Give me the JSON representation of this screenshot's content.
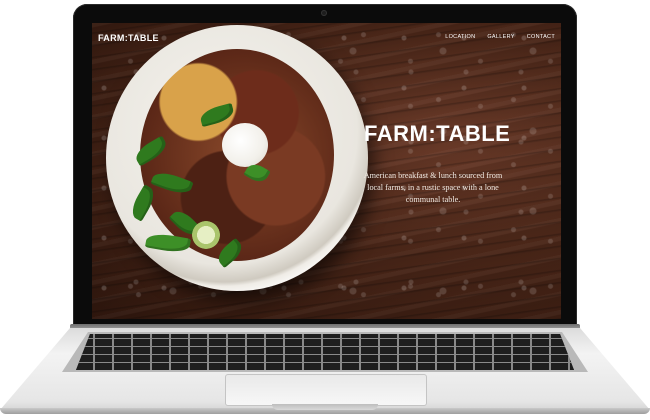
{
  "site": {
    "brand": "FARM:TABLE",
    "nav": [
      "LOCATION",
      "GALLERY",
      "CONTACT"
    ]
  },
  "hero": {
    "title": "FARM:TABLE",
    "subtitle_line1": "American breakfast & lunch sourced from",
    "subtitle_line2": "local farms, in a rustic space with a lone",
    "subtitle_line3": "communal table."
  },
  "colors": {
    "nav_text": "#ffffff",
    "wood": "#4a2618",
    "lid": "#0b0b0b",
    "body": "#e6e6e6"
  }
}
